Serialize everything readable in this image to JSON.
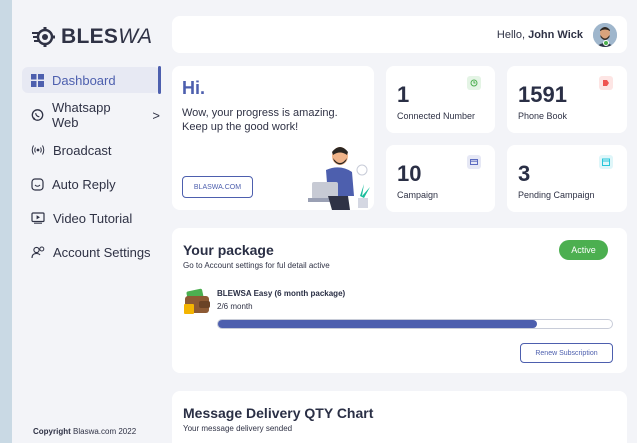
{
  "brand": {
    "name_bold": "BLES",
    "name_italic": "WA"
  },
  "sidebar": {
    "items": [
      {
        "label": "Dashboard",
        "icon": "grid-icon",
        "active": true
      },
      {
        "label": "Whatsapp Web",
        "icon": "whatsapp-icon",
        "chevron": ">"
      },
      {
        "label": "Broadcast",
        "icon": "broadcast-icon"
      },
      {
        "label": "Auto Reply",
        "icon": "chat-icon"
      },
      {
        "label": "Video Tutorial",
        "icon": "video-icon"
      },
      {
        "label": "Account Settings",
        "icon": "user-gear-icon"
      }
    ],
    "copyright_bold": "Copyright",
    "copyright_rest": " Blaswa.com 2022"
  },
  "header": {
    "greeting": "Hello, ",
    "user_name": "John Wick"
  },
  "welcome": {
    "title": "Hi.",
    "message": "Wow, your progress is amazing. Keep up the good work!",
    "site_button": "BLASWA.COM"
  },
  "stats": [
    {
      "value": "1",
      "label": "Connected Number",
      "icon": "clock-icon",
      "color": "#4caf50"
    },
    {
      "value": "1591",
      "label": "Phone Book",
      "icon": "tag-icon",
      "color": "#ef5350"
    },
    {
      "value": "10",
      "label": "Campaign",
      "icon": "card-icon",
      "color": "#5c6bc0"
    },
    {
      "value": "3",
      "label": "Pending Campaign",
      "icon": "calendar-icon",
      "color": "#26c6da"
    }
  ],
  "package": {
    "title": "Your package",
    "subtitle": "Go to Account settings for ful detail active",
    "status": "Active",
    "plan_name": "BLEWSA Easy (6 month package)",
    "plan_months": "2/6 month",
    "progress_percent": 81,
    "renew_button": "Renew Subscription"
  },
  "chart_section": {
    "title": "Message Delivery QTY Chart",
    "subtitle": "Your message delivery sended"
  },
  "colors": {
    "accent": "#4d5fae",
    "active_badge": "#4caf50",
    "background": "#f3f4f8"
  }
}
